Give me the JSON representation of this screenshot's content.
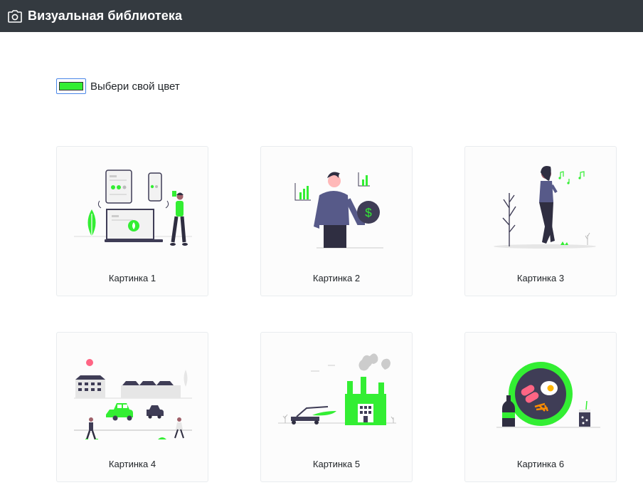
{
  "header": {
    "title": "Визуальная библиотека",
    "icon": "camera-icon"
  },
  "picker": {
    "label": "Выбери свой цвет",
    "value": "#33ee33"
  },
  "accent": "#33ee33",
  "cards": [
    {
      "caption": "Картинка 1"
    },
    {
      "caption": "Картинка 2"
    },
    {
      "caption": "Картинка 3"
    },
    {
      "caption": "Картинка 4"
    },
    {
      "caption": "Картинка 5"
    },
    {
      "caption": "Картинка 6"
    }
  ]
}
